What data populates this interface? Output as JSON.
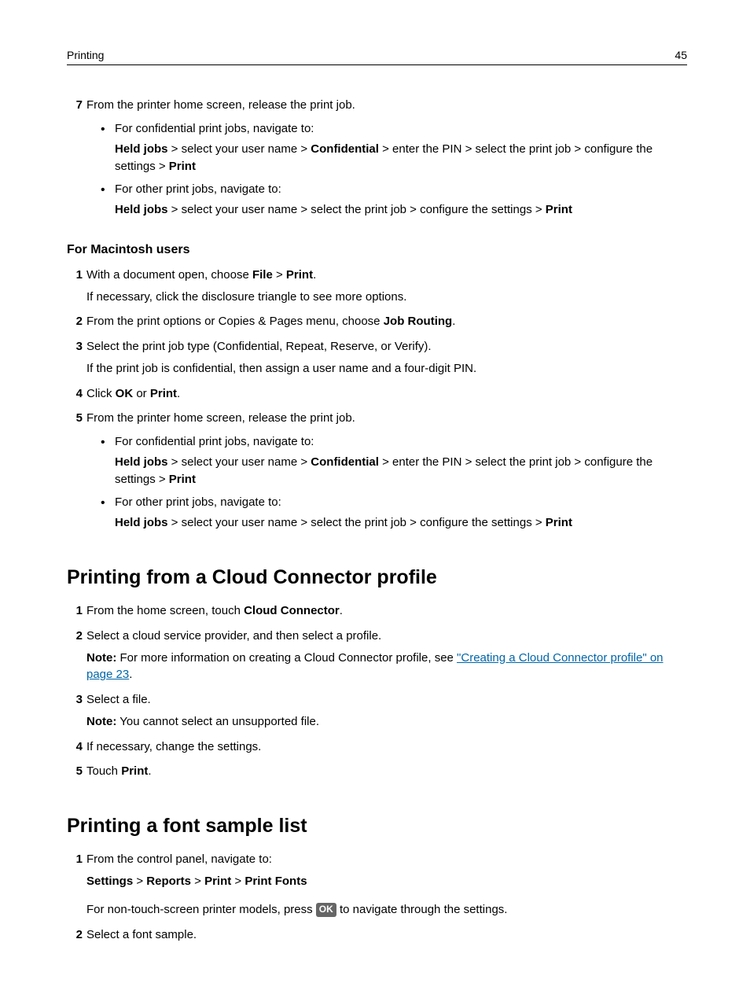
{
  "header": {
    "section": "Printing",
    "page": "45"
  },
  "step7": {
    "num": "7",
    "text": "From the printer home screen, release the print job.",
    "b1_intro": "For confidential print jobs, navigate to:",
    "b1_path_a": "Held jobs",
    "b1_path_b": " > select your user name > ",
    "b1_path_c": "Confidential",
    "b1_path_d": " > enter the PIN > select the print job > configure the settings > ",
    "b1_path_e": "Print",
    "b2_intro": "For other print jobs, navigate to:",
    "b2_path_a": "Held jobs",
    "b2_path_b": " > select your user name > select the print job > configure the settings > ",
    "b2_path_c": "Print"
  },
  "mac": {
    "heading": "For Macintosh users",
    "s1_num": "1",
    "s1_a": "With a document open, choose ",
    "s1_b": "File",
    "s1_c": " > ",
    "s1_d": "Print",
    "s1_e": ".",
    "s1_note": "If necessary, click the disclosure triangle to see more options.",
    "s2_num": "2",
    "s2_a": "From the print options or Copies & Pages menu, choose ",
    "s2_b": "Job Routing",
    "s2_c": ".",
    "s3_num": "3",
    "s3_a": "Select the print job type (Confidential, Repeat, Reserve, or Verify).",
    "s3_note": "If the print job is confidential, then assign a user name and a four-digit PIN.",
    "s4_num": "4",
    "s4_a": "Click ",
    "s4_b": "OK",
    "s4_c": " or ",
    "s4_d": "Print",
    "s4_e": ".",
    "s5_num": "5",
    "s5_a": "From the printer home screen, release the print job.",
    "s5_b1_intro": "For confidential print jobs, navigate to:",
    "s5_b1_a": "Held jobs",
    "s5_b1_b": " > select your user name > ",
    "s5_b1_c": "Confidential",
    "s5_b1_d": " > enter the PIN > select the print job > configure the settings > ",
    "s5_b1_e": "Print",
    "s5_b2_intro": "For other print jobs, navigate to:",
    "s5_b2_a": "Held jobs",
    "s5_b2_b": " > select your user name > select the print job > configure the settings > ",
    "s5_b2_c": "Print"
  },
  "cloud": {
    "heading": "Printing from a Cloud Connector profile",
    "s1_num": "1",
    "s1_a": "From the home screen, touch ",
    "s1_b": "Cloud Connector",
    "s1_c": ".",
    "s2_num": "2",
    "s2_a": "Select a cloud service provider, and then select a profile.",
    "s2_note_a": "Note:",
    "s2_note_b": " For more information on creating a Cloud Connector profile, see ",
    "s2_link": "\"Creating a Cloud Connector profile\" on page 23",
    "s2_note_c": ".",
    "s3_num": "3",
    "s3_a": "Select a file.",
    "s3_note_a": "Note:",
    "s3_note_b": " You cannot select an unsupported file.",
    "s4_num": "4",
    "s4_a": "If necessary, change the settings.",
    "s5_num": "5",
    "s5_a": "Touch ",
    "s5_b": "Print",
    "s5_c": "."
  },
  "font": {
    "heading": "Printing a font sample list",
    "s1_num": "1",
    "s1_a": "From the control panel, navigate to:",
    "s1_path_a": "Settings",
    "s1_gt1": " > ",
    "s1_path_b": "Reports",
    "s1_gt2": " > ",
    "s1_path_c": "Print",
    "s1_gt3": " > ",
    "s1_path_d": "Print Fonts",
    "s1_note_a": "For non-touch-screen printer models, press ",
    "s1_ok": "OK",
    "s1_note_b": " to navigate through the settings.",
    "s2_num": "2",
    "s2_a": "Select a font sample."
  }
}
